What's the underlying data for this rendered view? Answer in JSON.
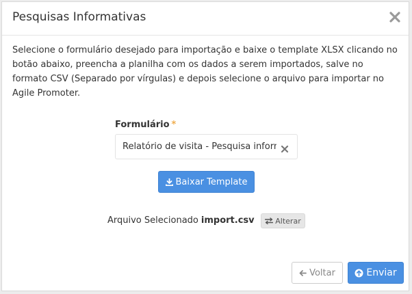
{
  "modal": {
    "title": "Pesquisas Informativas",
    "description": "Selecione o formulário desejado para importação e baixe o template XLSX clicando no botão abaixo, preencha a planilha com os dados a serem importados, salve no formato CSV (Separado por vírgulas) e depois selecione o arquivo para importar no Agile Promoter."
  },
  "form": {
    "label": "Formulário",
    "required_mark": "*",
    "selected_value": "Relatório de visita - Pesquisa informativa"
  },
  "download_button": {
    "label": "Baixar Template"
  },
  "file": {
    "label": "Arquivo Selecionado",
    "name": "import.csv",
    "change_label": "Alterar"
  },
  "footer": {
    "back_label": "Voltar",
    "send_label": "Enviar"
  },
  "colors": {
    "primary": "#4a90e2",
    "required": "#f0ad4e"
  },
  "icons": {
    "close": "close-icon",
    "clear": "clear-icon",
    "download": "download-icon",
    "exchange": "exchange-icon",
    "back": "arrow-left-icon",
    "send": "circle-arrow-up-icon"
  }
}
